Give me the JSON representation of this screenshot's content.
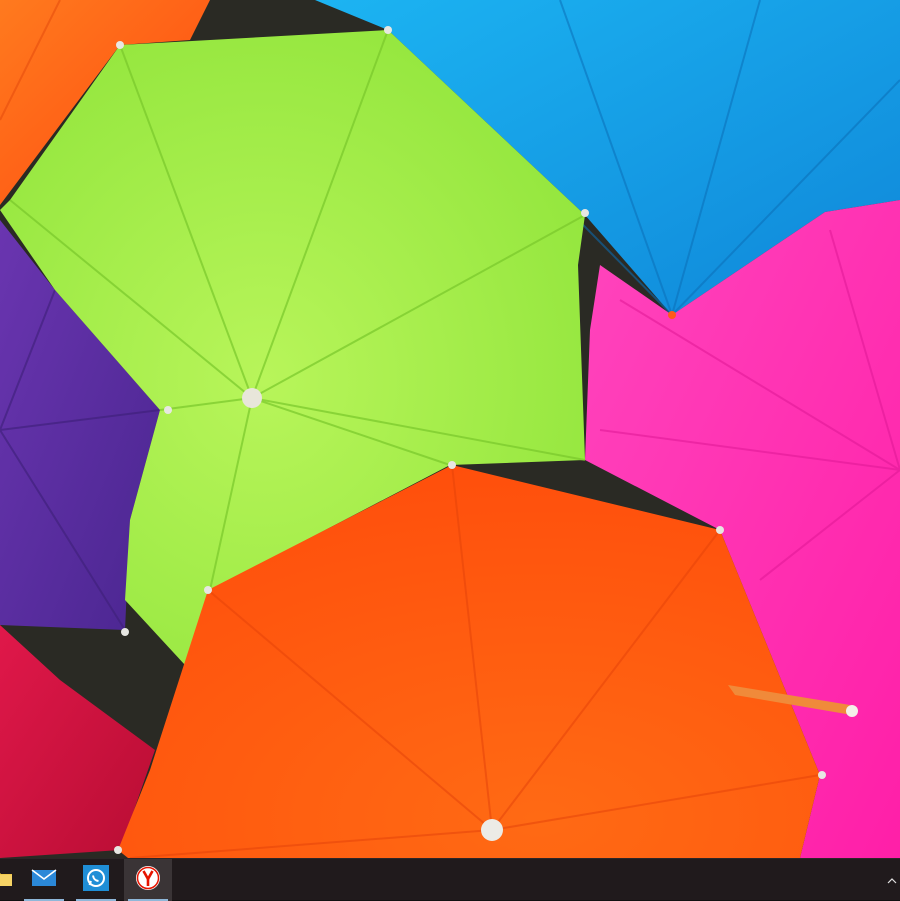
{
  "desktop": {
    "wallpaper": {
      "colors": {
        "orange_top_left": "#ff5e16",
        "lime": "#a6f04a",
        "blue": "#1aa7ef",
        "purple": "#5a2ea2",
        "magenta": "#ff2fb2",
        "red": "#d4113d",
        "orange_bottom": "#ff5a12"
      }
    }
  },
  "taskbar": {
    "background": "#201a1c",
    "items": [
      {
        "icon": "folder-icon",
        "running": false,
        "active": false
      },
      {
        "icon": "mail-icon",
        "running": true,
        "active": false
      },
      {
        "icon": "whatsapp-icon",
        "running": true,
        "active": false
      },
      {
        "icon": "yandex-browser-icon",
        "running": true,
        "active": true
      }
    ],
    "tray": {
      "icon": "chevron-up-icon"
    }
  }
}
